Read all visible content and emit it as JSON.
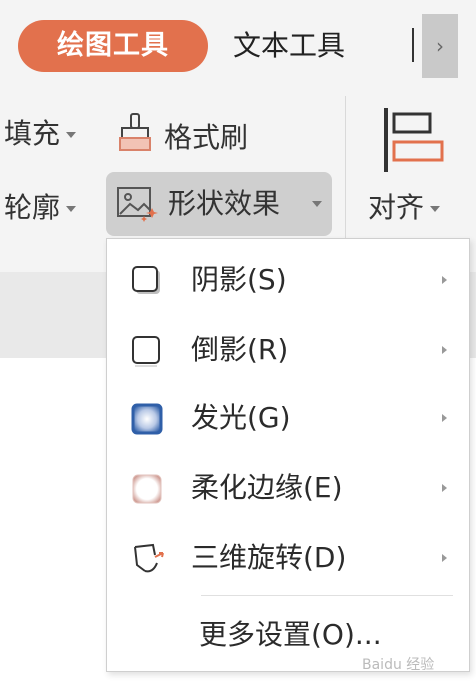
{
  "tabs": {
    "active": "绘图工具",
    "other": "文本工具"
  },
  "ribbon": {
    "fill_label": "填充",
    "outline_label": "轮廓",
    "format_painter_label": "格式刷",
    "shape_effects_label": "形状效果",
    "align_label": "对齐"
  },
  "menu": {
    "items": [
      {
        "label": "阴影(S)",
        "icon": "shadow-square-icon"
      },
      {
        "label": "倒影(R)",
        "icon": "reflection-square-icon"
      },
      {
        "label": "发光(G)",
        "icon": "glow-square-icon"
      },
      {
        "label": "柔化边缘(E)",
        "icon": "soft-edge-square-icon"
      },
      {
        "label": "三维旋转(D)",
        "icon": "3d-rotation-icon"
      }
    ],
    "more_label": "更多设置(O)..."
  },
  "watermark": "Baidu 经验",
  "colors": {
    "accent": "#e2714d",
    "glow": "#2f5fa8",
    "soft_edge": "#c98f86"
  }
}
